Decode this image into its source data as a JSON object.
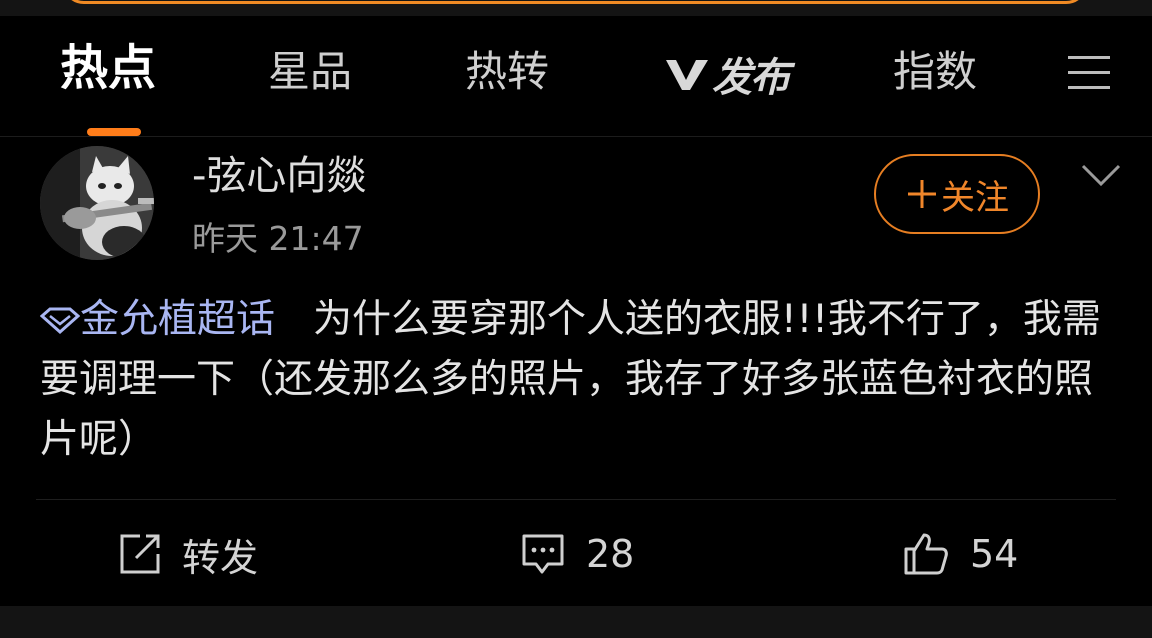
{
  "colors": {
    "accent": "#ff7d1a",
    "topic_link": "#a9b6f2",
    "background": "#000000"
  },
  "tabs": [
    {
      "label": "热点",
      "active": true
    },
    {
      "label": "星品",
      "active": false
    },
    {
      "label": "热转",
      "active": false
    },
    {
      "label": "发布",
      "active": false,
      "icon": "v-logo-icon"
    },
    {
      "label": "指数",
      "active": false
    }
  ],
  "menu_icon": "hamburger-menu-icon",
  "post": {
    "avatar_icon": "guitar-cat-avatar",
    "username": "-弦心向燚",
    "time": "昨天 21:47",
    "follow_label": "关注",
    "follow_icon": "plus-icon",
    "more_icon": "chevron-down-icon",
    "topic_icon": "diamond-icon",
    "topic": "金允植超话",
    "text": "为什么要穿那个人送的衣服!!!我不行了，我需要调理一下（还发那么多的照片，我存了好多张蓝色衬衣的照片呢）"
  },
  "actions": {
    "repost": {
      "label": "转发",
      "icon": "share-icon"
    },
    "comment": {
      "count": "28",
      "icon": "comment-icon"
    },
    "like": {
      "count": "54",
      "icon": "thumbs-up-icon"
    }
  }
}
